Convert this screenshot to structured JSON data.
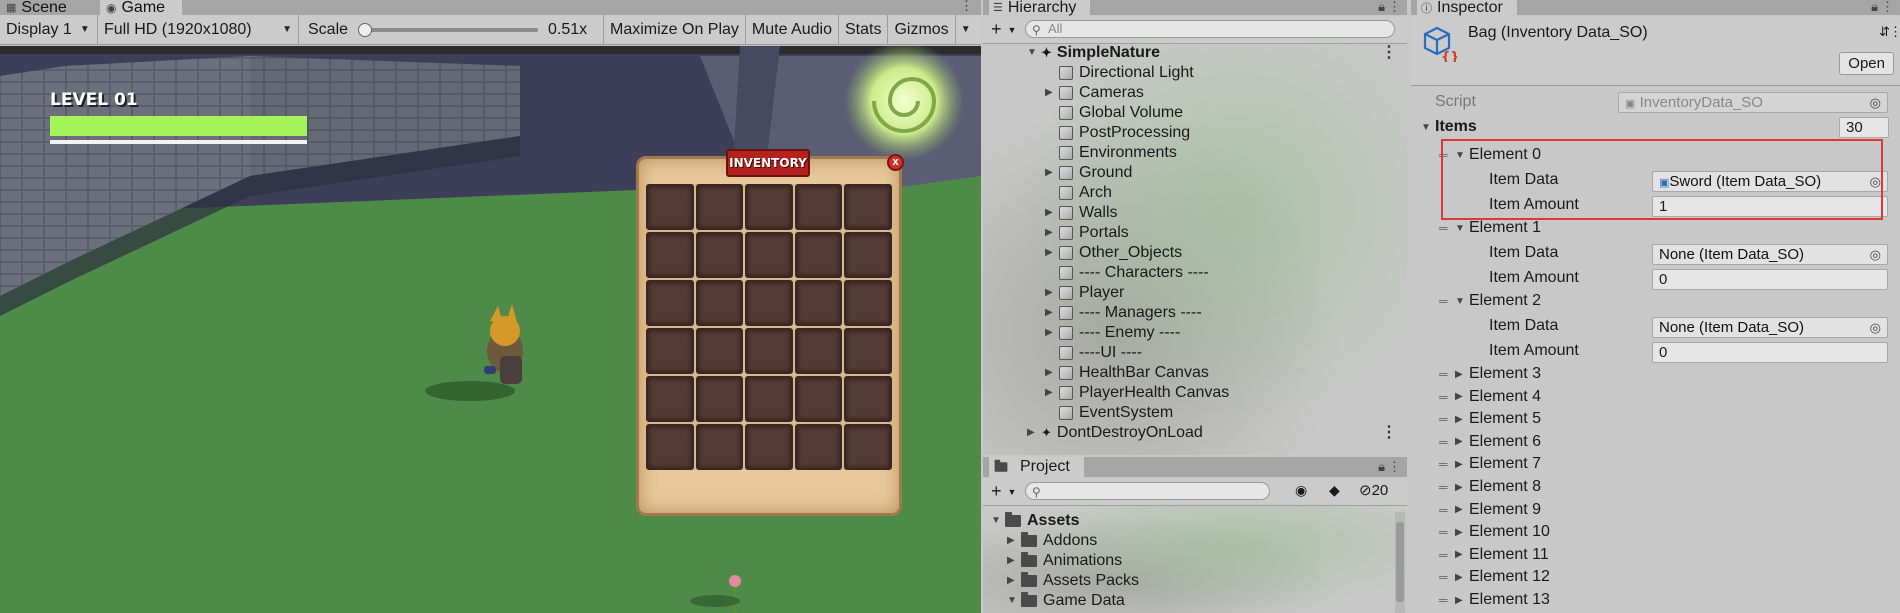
{
  "game_panel": {
    "tabs": [
      {
        "label": "Scene",
        "icon": "scene-grid-icon"
      },
      {
        "label": "Game",
        "icon": "gamepad-icon"
      }
    ],
    "toolbar": {
      "display": "Display 1",
      "resolution": "Full HD (1920x1080)",
      "scale_label": "Scale",
      "scale_value": "0.51x",
      "maximize": "Maximize On Play",
      "mute": "Mute Audio",
      "stats": "Stats",
      "gizmos": "Gizmos"
    },
    "hud": {
      "level": "LEVEL 01",
      "health_fill": 1.0,
      "health_color": "#a5f25a"
    },
    "inventory": {
      "title": "INVENTORY",
      "close": "x",
      "rows": 6,
      "cols": 5
    }
  },
  "hierarchy": {
    "title": "Hierarchy",
    "search_placeholder": "All",
    "scene": "SimpleNature",
    "items": [
      {
        "label": "Directional Light",
        "expandable": false
      },
      {
        "label": "Cameras",
        "expandable": true
      },
      {
        "label": "Global Volume",
        "expandable": false
      },
      {
        "label": "PostProcessing",
        "expandable": false
      },
      {
        "label": "Environments",
        "expandable": false
      },
      {
        "label": "Ground",
        "expandable": true
      },
      {
        "label": "Arch",
        "expandable": false
      },
      {
        "label": "Walls",
        "expandable": true
      },
      {
        "label": "Portals",
        "expandable": true
      },
      {
        "label": "Other_Objects",
        "expandable": true
      },
      {
        "label": "---- Characters ----",
        "expandable": false
      },
      {
        "label": "Player",
        "expandable": true
      },
      {
        "label": "---- Managers ----",
        "expandable": true
      },
      {
        "label": "---- Enemy ----",
        "expandable": true
      },
      {
        "label": "----UI ----",
        "expandable": false
      },
      {
        "label": "HealthBar Canvas",
        "expandable": true
      },
      {
        "label": "PlayerHealth Canvas",
        "expandable": true
      },
      {
        "label": "EventSystem",
        "expandable": false
      }
    ],
    "dont_destroy": "DontDestroyOnLoad"
  },
  "project": {
    "title": "Project",
    "hidden_count": "20",
    "root": "Assets",
    "folders": [
      {
        "label": "Addons",
        "expanded": false
      },
      {
        "label": "Animations",
        "expanded": false
      },
      {
        "label": "Assets Packs",
        "expanded": false
      },
      {
        "label": "Game Data",
        "expanded": true
      }
    ]
  },
  "inspector": {
    "title": "Inspector",
    "object_name": "Bag (Inventory Data_SO)",
    "open_label": "Open",
    "script_label": "Script",
    "script_value": "InventoryData_SO",
    "items_label": "Items",
    "items_count": "30",
    "elements": [
      {
        "label": "Element 0",
        "item_data_label": "Item Data",
        "item_data": "Sword (Item Data_SO)",
        "item_amount_label": "Item Amount",
        "item_amount": "1"
      },
      {
        "label": "Element 1",
        "item_data_label": "Item Data",
        "item_data": "None (Item Data_SO)",
        "item_amount_label": "Item Amount",
        "item_amount": "0"
      },
      {
        "label": "Element 2",
        "item_data_label": "Item Data",
        "item_data": "None (Item Data_SO)",
        "item_amount_label": "Item Amount",
        "item_amount": "0"
      }
    ],
    "collapsed_elements": [
      "Element 3",
      "Element 4",
      "Element 5",
      "Element 6",
      "Element 7",
      "Element 8",
      "Element 9",
      "Element 10",
      "Element 11",
      "Element 12",
      "Element 13"
    ],
    "highlight_color": "#e0353b"
  }
}
